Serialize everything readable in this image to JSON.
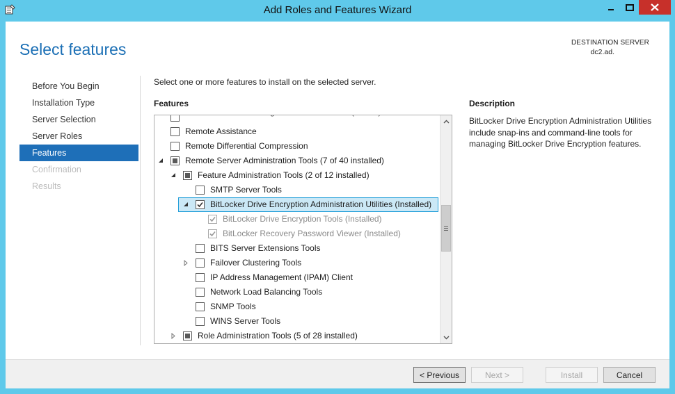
{
  "window": {
    "title": "Add Roles and Features Wizard"
  },
  "header": {
    "page_title": "Select features",
    "destination_label": "DESTINATION SERVER",
    "destination_value": "dc2.ad."
  },
  "nav": {
    "items": [
      {
        "label": "Before You Begin",
        "state": "normal"
      },
      {
        "label": "Installation Type",
        "state": "normal"
      },
      {
        "label": "Server Selection",
        "state": "normal"
      },
      {
        "label": "Server Roles",
        "state": "normal"
      },
      {
        "label": "Features",
        "state": "active"
      },
      {
        "label": "Confirmation",
        "state": "disabled"
      },
      {
        "label": "Results",
        "state": "disabled"
      }
    ]
  },
  "main": {
    "intro": "Select one or more features to install on the selected server.",
    "features_heading": "Features",
    "description_heading": "Description",
    "description_text": "BitLocker Drive Encryption Administration Utilities include snap-ins and command-line tools for managing BitLocker Drive Encryption features."
  },
  "tree": {
    "items": [
      {
        "label": "RAS Connection Manager Administration Kit (CMAK)",
        "level": 0,
        "expander": "none",
        "check": "none"
      },
      {
        "label": "Remote Assistance",
        "level": 0,
        "expander": "none",
        "check": "none"
      },
      {
        "label": "Remote Differential Compression",
        "level": 0,
        "expander": "none",
        "check": "none"
      },
      {
        "label": "Remote Server Administration Tools (7 of 40 installed)",
        "level": 0,
        "expander": "expanded",
        "check": "partial"
      },
      {
        "label": "Feature Administration Tools (2 of 12 installed)",
        "level": 1,
        "expander": "expanded",
        "check": "partial"
      },
      {
        "label": "SMTP Server Tools",
        "level": 2,
        "expander": "none",
        "check": "none"
      },
      {
        "label": "BitLocker Drive Encryption Administration Utilities (Installed)",
        "level": 2,
        "expander": "expanded",
        "check": "checked",
        "selected": true
      },
      {
        "label": "BitLocker Drive Encryption Tools (Installed)",
        "level": 3,
        "expander": "none",
        "check": "checked-gray"
      },
      {
        "label": "BitLocker Recovery Password Viewer (Installed)",
        "level": 3,
        "expander": "none",
        "check": "checked-gray"
      },
      {
        "label": "BITS Server Extensions Tools",
        "level": 2,
        "expander": "none",
        "check": "none"
      },
      {
        "label": "Failover Clustering Tools",
        "level": 2,
        "expander": "collapsed",
        "check": "none"
      },
      {
        "label": "IP Address Management (IPAM) Client",
        "level": 2,
        "expander": "none",
        "check": "none"
      },
      {
        "label": "Network Load Balancing Tools",
        "level": 2,
        "expander": "none",
        "check": "none"
      },
      {
        "label": "SNMP Tools",
        "level": 2,
        "expander": "none",
        "check": "none"
      },
      {
        "label": "WINS Server Tools",
        "level": 2,
        "expander": "none",
        "check": "none"
      },
      {
        "label": "Role Administration Tools (5 of 28 installed)",
        "level": 1,
        "expander": "collapsed",
        "check": "partial"
      }
    ]
  },
  "footer": {
    "previous_label": "< Previous",
    "next_label": "Next >",
    "install_label": "Install",
    "cancel_label": "Cancel"
  },
  "colors": {
    "titlebar": "#5fc9ea",
    "accent": "#1e6fb8",
    "close": "#c7302a",
    "selection_bg": "#cbe8f6",
    "selection_border": "#26a0da"
  }
}
